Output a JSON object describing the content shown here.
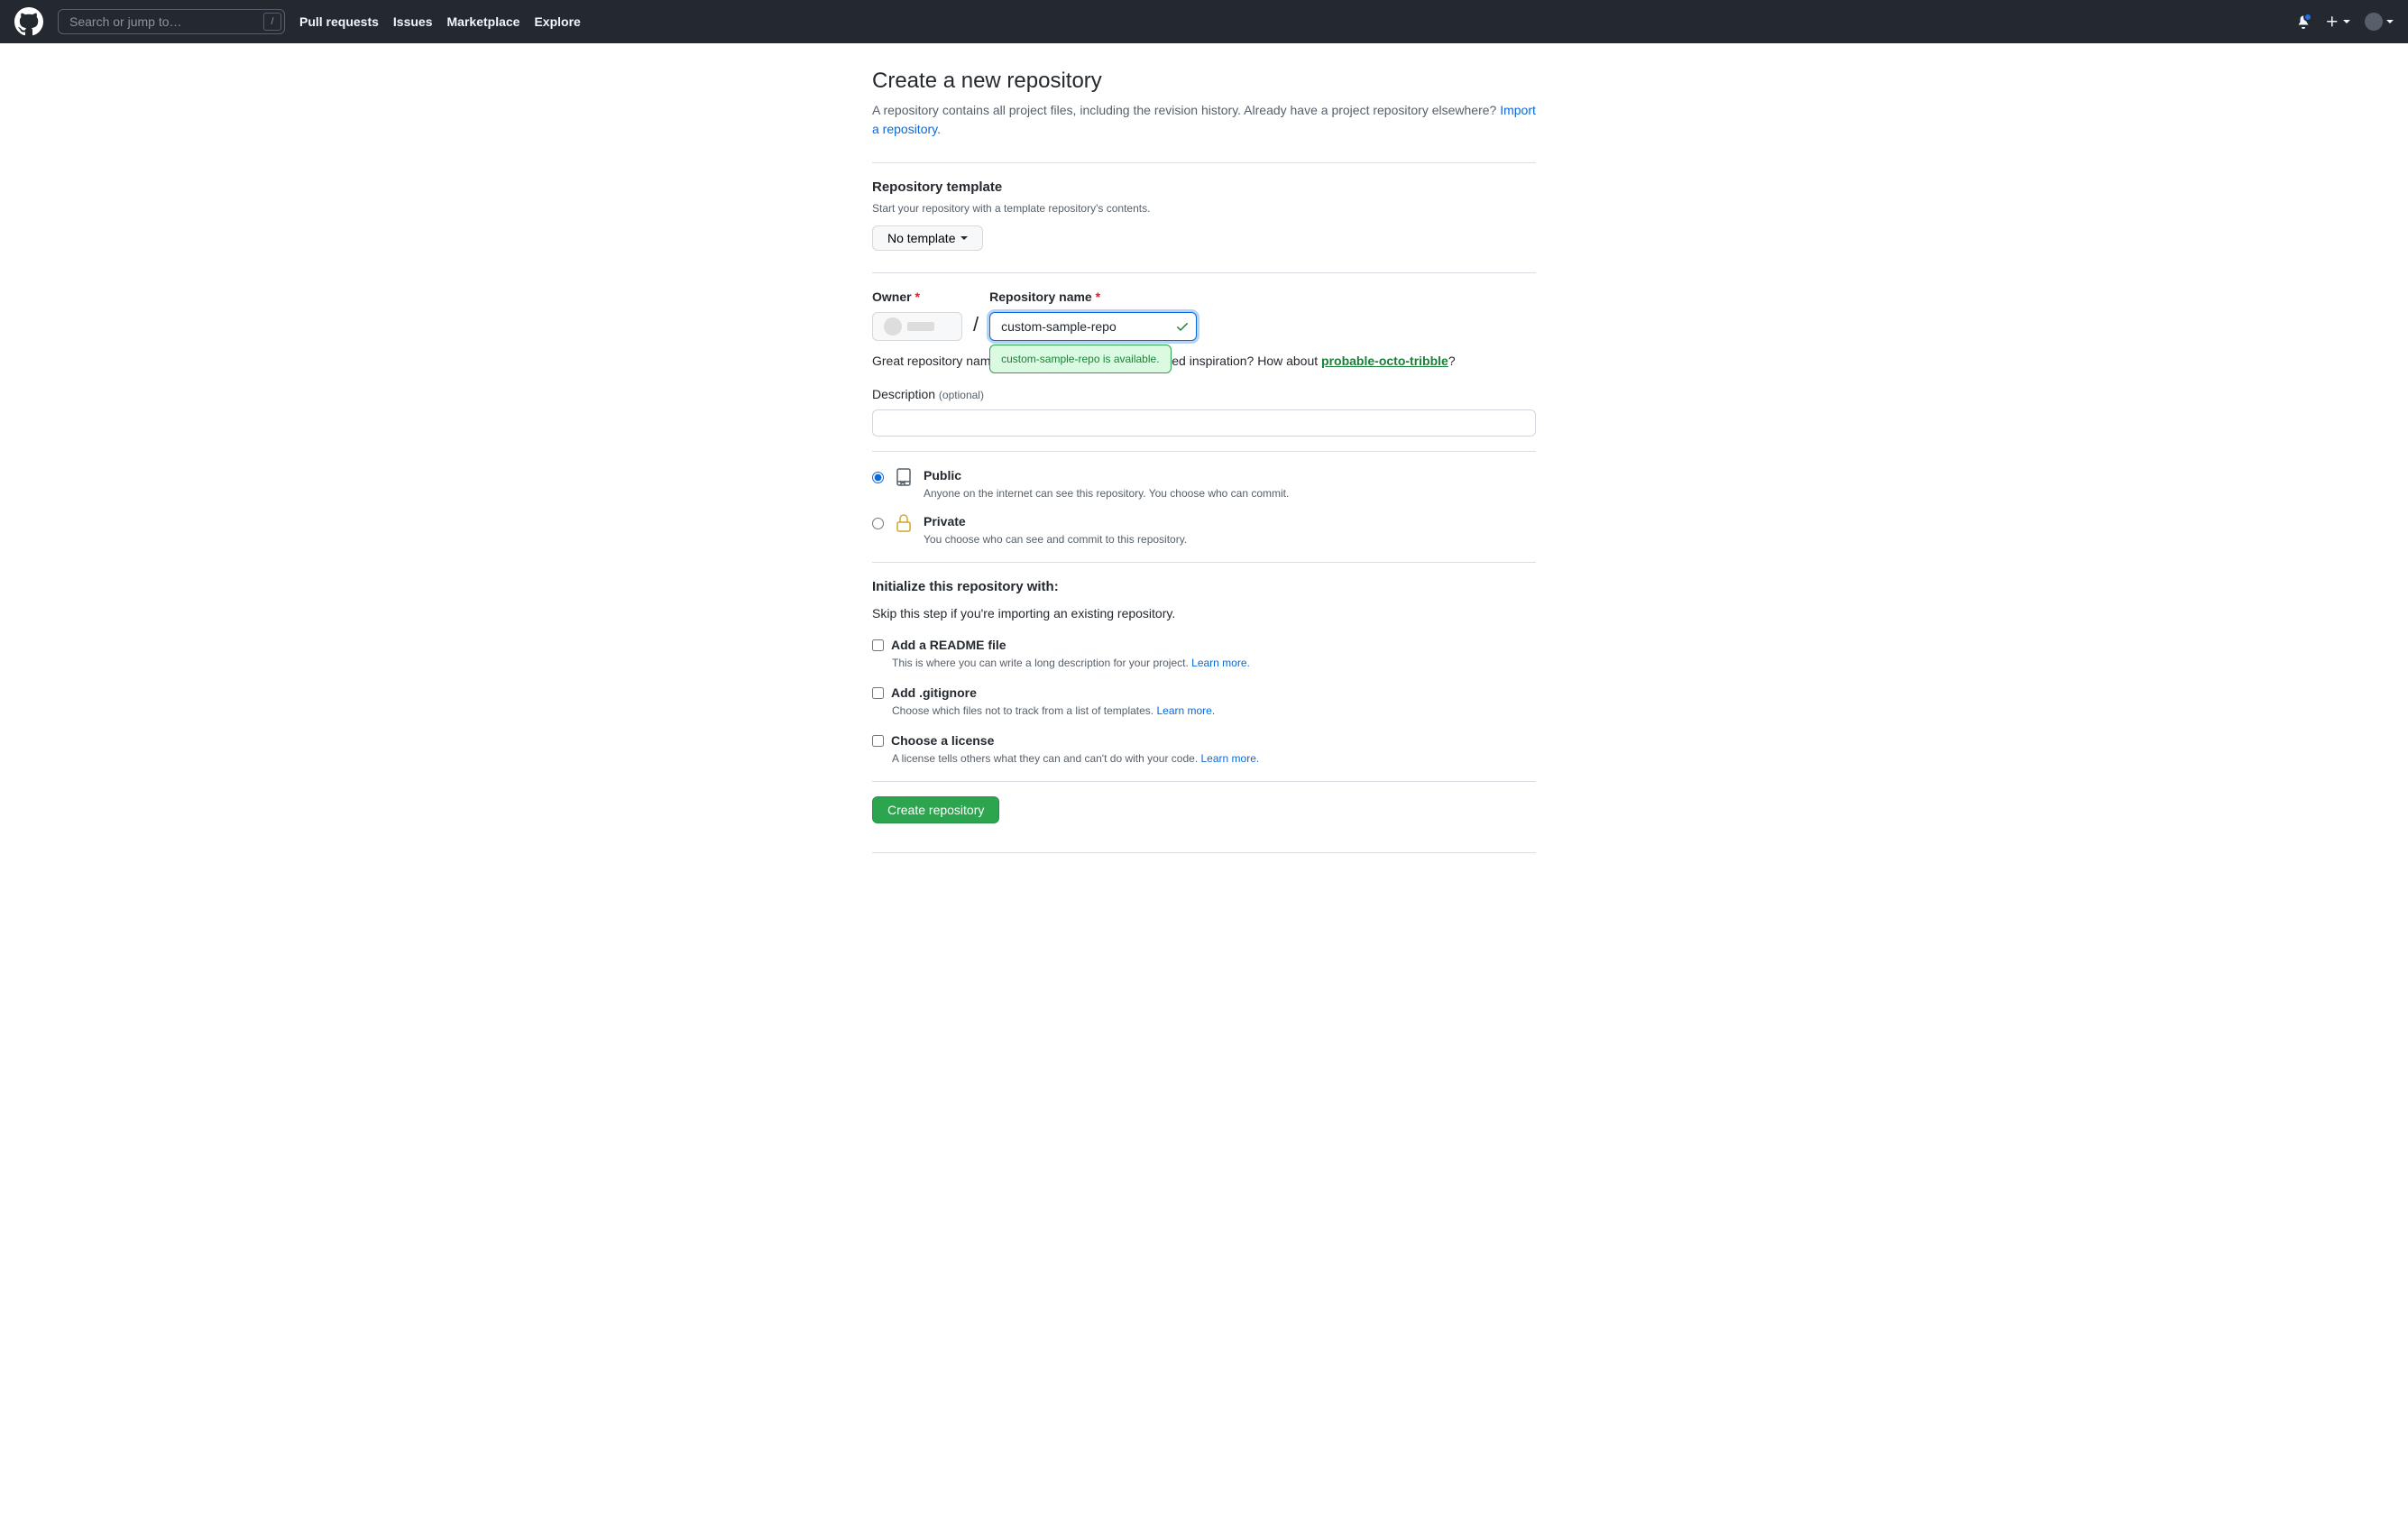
{
  "header": {
    "search_placeholder": "Search or jump to…",
    "slash_key": "/",
    "nav": {
      "pull_requests": "Pull requests",
      "issues": "Issues",
      "marketplace": "Marketplace",
      "explore": "Explore"
    }
  },
  "page": {
    "title": "Create a new repository",
    "subtitle_prefix": "A repository contains all project files, including the revision history. Already have a project repository elsewhere? ",
    "import_link": "Import a repository."
  },
  "template": {
    "heading": "Repository template",
    "desc": "Start your repository with a template repository's contents.",
    "button": "No template"
  },
  "owner": {
    "label": "Owner"
  },
  "repo_name": {
    "label": "Repository name",
    "value": "custom-sample-repo",
    "availability": "custom-sample-repo is available."
  },
  "hint": {
    "prefix": "Great repository names are short and memorable. Need inspiration? How about ",
    "suggestion": "probable-octo-tribble",
    "suffix": "?"
  },
  "description": {
    "label": "Description",
    "optional": "(optional)"
  },
  "visibility": {
    "public": {
      "title": "Public",
      "desc": "Anyone on the internet can see this repository. You choose who can commit."
    },
    "private": {
      "title": "Private",
      "desc": "You choose who can see and commit to this repository."
    }
  },
  "initialize": {
    "heading": "Initialize this repository with:",
    "skip": "Skip this step if you're importing an existing repository.",
    "readme": {
      "title": "Add a README file",
      "desc": "This is where you can write a long description for your project. ",
      "learn": "Learn more."
    },
    "gitignore": {
      "title": "Add .gitignore",
      "desc": "Choose which files not to track from a list of templates. ",
      "learn": "Learn more."
    },
    "license": {
      "title": "Choose a license",
      "desc": "A license tells others what they can and can't do with your code. ",
      "learn": "Learn more."
    }
  },
  "submit": {
    "label": "Create repository"
  }
}
